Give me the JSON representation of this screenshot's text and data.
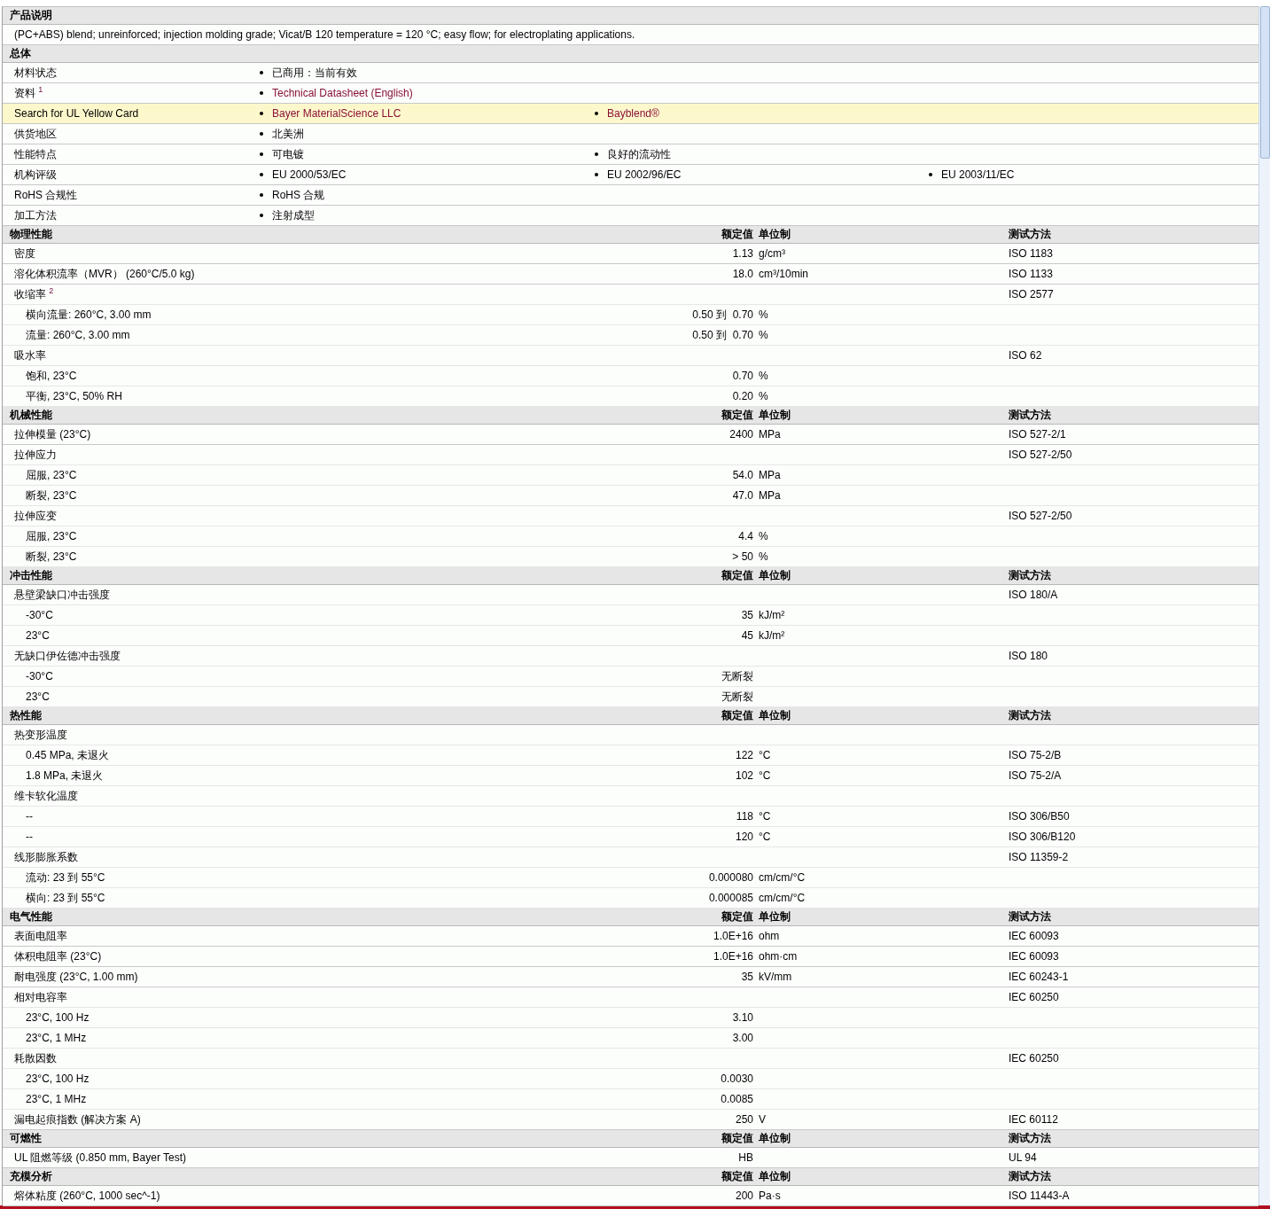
{
  "description": {
    "title": "产品说明",
    "text": "(PC+ABS) blend; unreinforced; injection molding grade; Vicat/B 120 temperature = 120 °C; easy flow; for electroplating applications."
  },
  "general": {
    "title": "总体",
    "rows": [
      {
        "label": "材料状态",
        "highlighted": false,
        "items": [
          {
            "text": "已商用：当前有效",
            "link": false
          }
        ]
      },
      {
        "label": "资料 $^{1}$",
        "highlighted": false,
        "items": [
          {
            "text": "Technical Datasheet (English)",
            "link": true
          }
        ]
      },
      {
        "label": "Search for UL Yellow Card",
        "highlighted": true,
        "items": [
          {
            "text": "Bayer MaterialScience LLC",
            "link": true
          },
          {
            "text": "Bayblend®",
            "link": true
          }
        ]
      },
      {
        "label": "供货地区",
        "highlighted": false,
        "items": [
          {
            "text": "北美洲",
            "link": false
          }
        ]
      },
      {
        "label": "性能特点",
        "highlighted": false,
        "items": [
          {
            "text": "可电镀",
            "link": false
          },
          {
            "text": "良好的流动性",
            "link": false
          }
        ]
      },
      {
        "label": "机构评级",
        "highlighted": false,
        "items": [
          {
            "text": "EU 2000/53/EC",
            "link": false
          },
          {
            "text": "EU 2002/96/EC",
            "link": false
          },
          {
            "text": "EU 2003/11/EC",
            "link": false
          }
        ]
      },
      {
        "label": "RoHS 合规性",
        "highlighted": false,
        "items": [
          {
            "text": "RoHS 合规",
            "link": false
          }
        ]
      },
      {
        "label": "加工方法",
        "highlighted": false,
        "items": [
          {
            "text": "注射成型",
            "link": false
          }
        ]
      }
    ]
  },
  "sections": [
    {
      "title": "物理性能",
      "value_header": "额定值",
      "unit_header": "单位制",
      "method_header": "测试方法",
      "rows": [
        {
          "label": "密度",
          "value": "1.13",
          "unit": "g/cm³",
          "method": "ISO 1183"
        },
        {
          "label": "溶化体积流率（MVR） (260°C/5.0 kg)",
          "value": "18.0",
          "unit": "cm³/10min",
          "method": "ISO 1133"
        },
        {
          "label": "收缩率 $^{2}$",
          "method": "ISO 2577",
          "children": [
            {
              "label": "横向流量: 260°C, 3.00 mm",
              "value": "0.50 到  0.70",
              "unit": "%"
            },
            {
              "label": "流量: 260°C, 3.00 mm",
              "value": "0.50 到  0.70",
              "unit": "%"
            }
          ]
        },
        {
          "label": "吸水率",
          "method": "ISO 62",
          "children": [
            {
              "label": "饱和, 23°C",
              "value": "0.70",
              "unit": "%"
            },
            {
              "label": "平衡, 23°C, 50% RH",
              "value": "0.20",
              "unit": "%"
            }
          ]
        }
      ]
    },
    {
      "title": "机械性能",
      "value_header": "额定值",
      "unit_header": "单位制",
      "method_header": "测试方法",
      "rows": [
        {
          "label": "拉伸模量 (23°C)",
          "value": "2400",
          "unit": "MPa",
          "method": "ISO 527-2/1"
        },
        {
          "label": "拉伸应力",
          "method": "ISO 527-2/50",
          "children": [
            {
              "label": "屈服, 23°C",
              "value": "54.0",
              "unit": "MPa"
            },
            {
              "label": "断裂, 23°C",
              "value": "47.0",
              "unit": "MPa"
            }
          ]
        },
        {
          "label": "拉伸应变",
          "method": "ISO 527-2/50",
          "children": [
            {
              "label": "屈服, 23°C",
              "value": "4.4",
              "unit": "%"
            },
            {
              "label": "断裂, 23°C",
              "value": "> 50",
              "unit": "%"
            }
          ]
        }
      ]
    },
    {
      "title": "冲击性能",
      "value_header": "额定值",
      "unit_header": "单位制",
      "method_header": "测试方法",
      "rows": [
        {
          "label": "悬壁梁缺口冲击强度",
          "method": "ISO 180/A",
          "children": [
            {
              "label": "-30°C",
              "value": "35",
              "unit": "kJ/m²"
            },
            {
              "label": "23°C",
              "value": "45",
              "unit": "kJ/m²"
            }
          ]
        },
        {
          "label": "无缺口伊佐德冲击强度",
          "method": "ISO 180",
          "children": [
            {
              "label": "-30°C",
              "value": "无断裂"
            },
            {
              "label": "23°C",
              "value": "无断裂"
            }
          ]
        }
      ]
    },
    {
      "title": "热性能",
      "value_header": "额定值",
      "unit_header": "单位制",
      "method_header": "测试方法",
      "rows": [
        {
          "label": "热变形温度",
          "children": [
            {
              "label": "0.45 MPa, 未退火",
              "value": "122",
              "unit": "°C",
              "method": "ISO 75-2/B"
            },
            {
              "label": "1.8 MPa, 未退火",
              "value": "102",
              "unit": "°C",
              "method": "ISO 75-2/A"
            }
          ]
        },
        {
          "label": "维卡软化温度",
          "children": [
            {
              "label": "--",
              "value": "118",
              "unit": "°C",
              "method": "ISO 306/B50"
            },
            {
              "label": "--",
              "value": "120",
              "unit": "°C",
              "method": "ISO 306/B120"
            }
          ]
        },
        {
          "label": "线形膨胀系数",
          "method": "ISO 11359-2",
          "children": [
            {
              "label": "流动: 23 到  55°C",
              "value": "0.000080",
              "unit": "cm/cm/°C"
            },
            {
              "label": "横向: 23 到  55°C",
              "value": "0.000085",
              "unit": "cm/cm/°C"
            }
          ]
        }
      ]
    },
    {
      "title": "电气性能",
      "value_header": "额定值",
      "unit_header": "单位制",
      "method_header": "测试方法",
      "rows": [
        {
          "label": "表面电阻率",
          "value": "1.0E+16",
          "unit": "ohm",
          "method": "IEC 60093"
        },
        {
          "label": "体积电阻率 (23°C)",
          "value": "1.0E+16",
          "unit": "ohm·cm",
          "method": "IEC 60093"
        },
        {
          "label": "耐电强度 (23°C, 1.00 mm)",
          "value": "35",
          "unit": "kV/mm",
          "method": "IEC 60243-1"
        },
        {
          "label": "相对电容率",
          "method": "IEC 60250",
          "children": [
            {
              "label": "23°C, 100 Hz",
              "value": "3.10"
            },
            {
              "label": "23°C, 1 MHz",
              "value": "3.00"
            }
          ]
        },
        {
          "label": "耗散因数",
          "method": "IEC 60250",
          "children": [
            {
              "label": "23°C, 100 Hz",
              "value": "0.0030"
            },
            {
              "label": "23°C, 1 MHz",
              "value": "0.0085"
            }
          ]
        },
        {
          "label": "漏电起痕指数 (解决方案  A)",
          "value": "250",
          "unit": "V",
          "method": "IEC 60112"
        }
      ]
    },
    {
      "title": "可燃性",
      "value_header": "额定值",
      "unit_header": "单位制",
      "method_header": "测试方法",
      "rows": [
        {
          "label": "UL 阻燃等级 (0.850 mm, Bayer Test)",
          "value": "HB",
          "method": "UL 94"
        }
      ]
    },
    {
      "title": "充模分析",
      "value_header": "额定值",
      "unit_header": "单位制",
      "method_header": "测试方法",
      "rows": [
        {
          "label": "熔体粘度 (260°C, 1000 sec^-1)",
          "value": "200",
          "unit": "Pa·s",
          "method": "ISO 11443-A"
        }
      ]
    }
  ]
}
